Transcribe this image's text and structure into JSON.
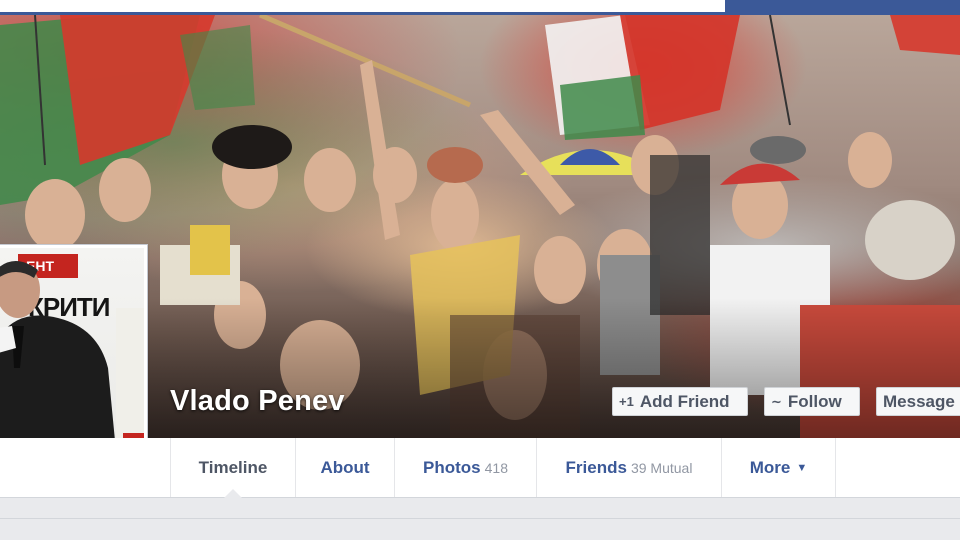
{
  "profile": {
    "name": "Vlado Penev",
    "picture_text": [
      "ЕНТ",
      "КРИТИ"
    ]
  },
  "actions": {
    "add_friend": {
      "label": "Add Friend",
      "icon": "add-friend-icon"
    },
    "follow": {
      "label": "Follow",
      "icon": "rss-icon"
    },
    "message": {
      "label": "Message"
    }
  },
  "tabs": [
    {
      "label": "Timeline",
      "active": true
    },
    {
      "label": "About"
    },
    {
      "label": "Photos",
      "count": "418"
    },
    {
      "label": "Friends",
      "count": "39 Mutual"
    },
    {
      "label": "More",
      "icon": "caret-down-icon"
    }
  ],
  "colors": {
    "brand_blue": "#3b5998",
    "link_blue": "#3b5998",
    "button_bg": "#f6f7f8",
    "page_bg": "#e9eaed"
  }
}
